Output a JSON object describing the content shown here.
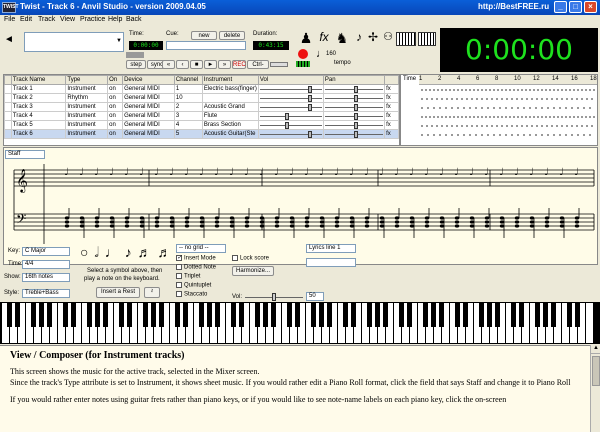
{
  "window": {
    "app_icon_text": "TWIST",
    "title": "Twist - Track 6 - Anvil Studio - version 2009.04.05",
    "watermark": "http://BestFREE.ru"
  },
  "menu": [
    "File",
    "Edit",
    "Track",
    "View",
    "Practice",
    "Help",
    "Back"
  ],
  "transport": {
    "time_label": "Time:",
    "time_value": "0:00:00",
    "cue_label": "Cue:",
    "new_label": "new",
    "delete_label": "delete",
    "cue_value": "0:00:00",
    "duration_label": "Duration:",
    "duration_value": "0:43:15",
    "step_label": "step",
    "sync_label": "sync",
    "rec_label": "REC",
    "ctrl_label": "Ctrl-",
    "tempo_value": "160",
    "tempo_label": "tempo",
    "big_clock": "0:00:00"
  },
  "mixer": {
    "headers": [
      "Track Name",
      "Type",
      "On",
      "Device",
      "Channel",
      "Instrument",
      "Vol",
      "Pan",
      "",
      "Time"
    ],
    "rows": [
      {
        "name": "Track 1",
        "type": "Instrument",
        "on": "on",
        "device": "General MIDI",
        "channel": "1",
        "instrument": "Electric bass(finger)",
        "vol": 0.78,
        "pan": 0.5
      },
      {
        "name": "Track 2",
        "type": "Rhythm",
        "on": "on",
        "device": "General MIDI",
        "channel": "10",
        "instrument": "",
        "vol": 0.78,
        "pan": 0.5
      },
      {
        "name": "Track 3",
        "type": "Instrument",
        "on": "on",
        "device": "General MIDI",
        "channel": "2",
        "instrument": "Acoustic Grand",
        "vol": 0.78,
        "pan": 0.5
      },
      {
        "name": "Track 4",
        "type": "Instrument",
        "on": "on",
        "device": "General MIDI",
        "channel": "3",
        "instrument": "Flute",
        "vol": 0.4,
        "pan": 0.5
      },
      {
        "name": "Track 5",
        "type": "Instrument",
        "on": "on",
        "device": "General MIDI",
        "channel": "4",
        "instrument": "Brass Section",
        "vol": 0.4,
        "pan": 0.5
      },
      {
        "name": "Track 6",
        "type": "Instrument",
        "on": "on",
        "device": "General MIDI",
        "channel": "5",
        "instrument": "Acoustic Guitar(Ste",
        "vol": 0.78,
        "pan": 0.5
      }
    ],
    "fx_label": "fx",
    "ruler": [
      "1",
      "2",
      "4",
      "6",
      "8",
      "10",
      "12",
      "14",
      "16",
      "18"
    ]
  },
  "staff": {
    "view_select": "Staff"
  },
  "controls": {
    "key_label": "Key:",
    "key_value": "C Major",
    "time_label": "Time:",
    "time_value": "4/4",
    "show_label": "Show:",
    "show_value": "16th notes",
    "style_label": "Style:",
    "style_value": "Treble+Bass",
    "hint_line1": "Select a symbol above, then",
    "hint_line2": "play a note on the keyboard.",
    "insert_rest": "Insert a Rest",
    "grid_select": "-- no grid --",
    "insert_mode": "Insert Mode",
    "dotted_note": "Dotted Note",
    "triplet": "Triplet",
    "quintuplet": "Quintuplet",
    "staccato": "Staccato",
    "lock_score": "Lock score",
    "harmonize": "Harmonize...",
    "lyrics_select": "Lyrics line 1",
    "vol_label": "Vol:",
    "vol_value": "50",
    "vol_level": 0.5
  },
  "help": {
    "title": "View / Composer (for Instrument tracks)",
    "p1": "This screen shows the music for the active track, selected in the Mixer screen.",
    "p2": "Since the track's Type attribute is set to Instrument, it shows sheet music. If you would rather edit a Piano Roll format, click the field that says Staff and change it to Piano Roll",
    "p3": "If you would rather enter notes using guitar frets rather than piano keys, or if you would like to see note-name labels on each piano key, click the on-screen"
  },
  "colors": {
    "lcd_green": "#1ee11e",
    "title_blue": "#0a5fd8",
    "staff_bg": "#fffce8"
  }
}
